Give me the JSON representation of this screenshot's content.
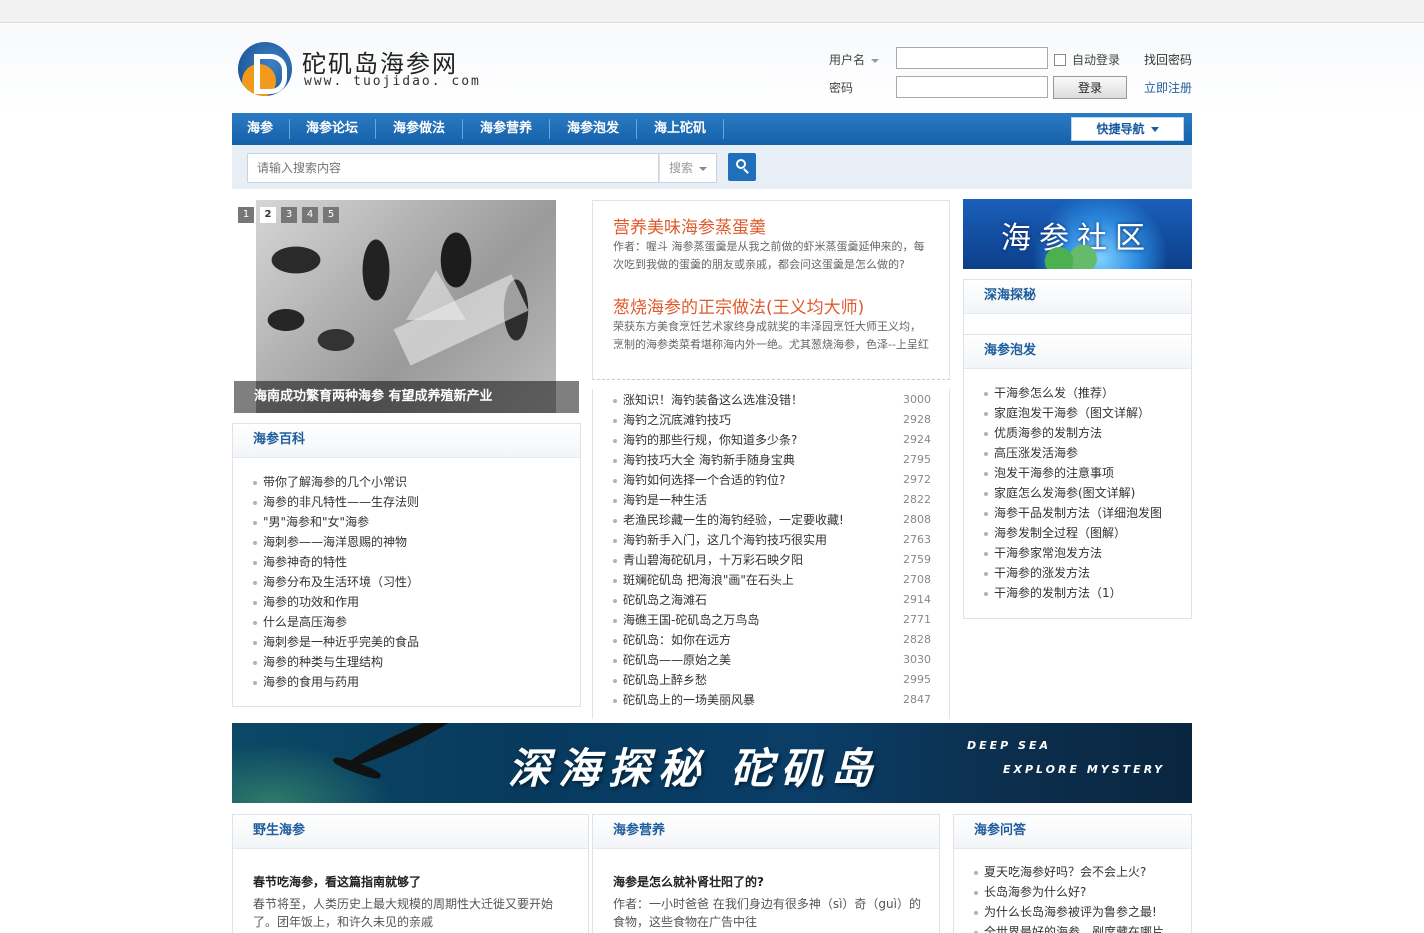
{
  "header": {
    "logo_cn": "砣矶岛海参网",
    "logo_en": "www. tuojidao. com",
    "login": {
      "username_label": "用户名",
      "password_label": "密码",
      "remember_label": "自动登录",
      "login_button": "登录",
      "forgot_link": "找回密码",
      "register_link": "立即注册"
    }
  },
  "nav": {
    "items": [
      "海参",
      "海参论坛",
      "海参做法",
      "海参营养",
      "海参泡发",
      "海上砣矶"
    ],
    "quick_nav": "快捷导航"
  },
  "search": {
    "placeholder": "请输入搜索内容",
    "select": "搜索"
  },
  "slideshow": {
    "pages": [
      "1",
      "2",
      "3",
      "4",
      "5"
    ],
    "active": "2",
    "caption": "海南成功繁育两种海参 有望成养殖新产业"
  },
  "baike": {
    "title": "海参百科",
    "items": [
      "带你了解海参的几个小常识",
      "海参的非凡特性——生存法则",
      "\"男\"海参和\"女\"海参",
      "海刺参——海洋恩赐的神物",
      "海参神奇的特性",
      "海参分布及生活环境（习性）",
      "海参的功效和作用",
      "什么是高压海参",
      "海刺参是一种近乎完美的食品",
      "海参的种类与生理结构",
      "海参的食用与药用"
    ]
  },
  "featured": [
    {
      "title": "营养美味海参蒸蛋羹",
      "desc": "作者：喔斗 海参蒸蛋羹是从我之前做的虾米蒸蛋羹延伸来的，每次吃到我做的蛋羹的朋友或亲戚，都会问这蛋羹是怎么做的?"
    },
    {
      "title": "葱烧海参的正宗做法(王义均大师)",
      "desc": "荣获东方美食烹饪艺术家终身成就奖的丰泽园烹饪大师王义均，烹制的海参类菜肴堪称海内外一绝。尤其葱烧海参，色泽--上呈红"
    }
  ],
  "center_list": [
    {
      "title": "涨知识！海钓装备这么选准没错！",
      "count": "3000"
    },
    {
      "title": "海钓之沉底滩钓技巧",
      "count": "2928"
    },
    {
      "title": "海钓的那些行规，你知道多少条?",
      "count": "2924"
    },
    {
      "title": "海钓技巧大全 海钓新手随身宝典",
      "count": "2795"
    },
    {
      "title": "海钓如何选择一个合适的钓位?",
      "count": "2972"
    },
    {
      "title": "海钓是一种生活",
      "count": "2822"
    },
    {
      "title": "老渔民珍藏一生的海钓经验，一定要收藏!",
      "count": "2808"
    },
    {
      "title": "海钓新手入门，这几个海钓技巧很实用",
      "count": "2763"
    },
    {
      "title": "青山碧海砣矶月，十万彩石映夕阳",
      "count": "2759"
    },
    {
      "title": "斑斓砣矶岛 把海浪\"画\"在石头上",
      "count": "2708"
    },
    {
      "title": "砣矶岛之海滩石",
      "count": "2914"
    },
    {
      "title": "海礁王国-砣矶岛之万鸟岛",
      "count": "2771"
    },
    {
      "title": "砣矶岛：如你在远方",
      "count": "2828"
    },
    {
      "title": "砣矶岛——原始之美",
      "count": "3030"
    },
    {
      "title": "砣矶岛上醉乡愁",
      "count": "2995"
    },
    {
      "title": "砣矶岛上的一场美丽风暴",
      "count": "2847"
    }
  ],
  "community": {
    "banner_text": "海参社区",
    "tanmi_title": "深海探秘",
    "paofa_title": "海参泡发",
    "paofa_items": [
      "干海参怎么发（推荐）",
      "家庭泡发干海参（图文详解）",
      "优质海参的发制方法",
      "高压涨发活海参",
      "泡发干海参的注意事项",
      "家庭怎么发海参(图文详解)",
      "海参干品发制方法（详细泡发图",
      "海参发制全过程（图解）",
      "干海参家常泡发方法",
      "干海参的涨发方法",
      "干海参的发制方法（1）"
    ]
  },
  "banner": {
    "cn": "深海探秘 砣矶岛",
    "en1": "DEEP SEA",
    "en2": "EXPLORE MYSTERY"
  },
  "bottom": {
    "wild": {
      "title": "野生海参",
      "article_title": "春节吃海参，看这篇指南就够了",
      "article_desc": "春节将至，人类历史上最大规模的周期性大迁徙又要开始了。团年饭上，和许久未见的亲戚"
    },
    "nutrition": {
      "title": "海参营养",
      "article_title": "海参是怎么就补肾壮阳了的?",
      "article_desc": "作者：一小时爸爸 在我们身边有很多神（sì）奇（guì）的食物，这些食物在广告中往"
    },
    "qa": {
      "title": "海参问答",
      "items": [
        "夏天吃海参好吗？会不会上火?",
        "长岛海参为什么好?",
        "为什么长岛海参被评为鲁参之最!",
        "全世界最好的海参，剐席藏在哪片"
      ]
    }
  }
}
